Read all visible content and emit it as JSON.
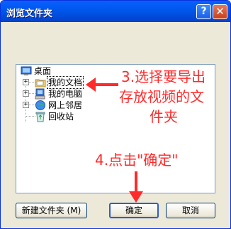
{
  "window": {
    "title": "浏览文件夹",
    "help_label": "?",
    "close_label": "✕"
  },
  "tree": {
    "items": [
      {
        "label": "桌面",
        "icon": "desktop-icon"
      },
      {
        "label": "我的文档",
        "icon": "folder-icon",
        "selected": true
      },
      {
        "label": "我的电脑",
        "icon": "computer-icon"
      },
      {
        "label": "网上邻居",
        "icon": "network-icon"
      },
      {
        "label": "回收站",
        "icon": "recycle-bin-icon"
      }
    ],
    "expander_symbol": "+"
  },
  "annotations": {
    "step3_line1": "3.选择要导出",
    "step3_line2": "存放视频的文",
    "step3_line3": "件夹",
    "step4": "4.点击\"确定\"",
    "color": "#ff2a2a"
  },
  "buttons": {
    "new_folder": "新建文件夹 (M)",
    "ok": "确定",
    "cancel": "取消"
  }
}
